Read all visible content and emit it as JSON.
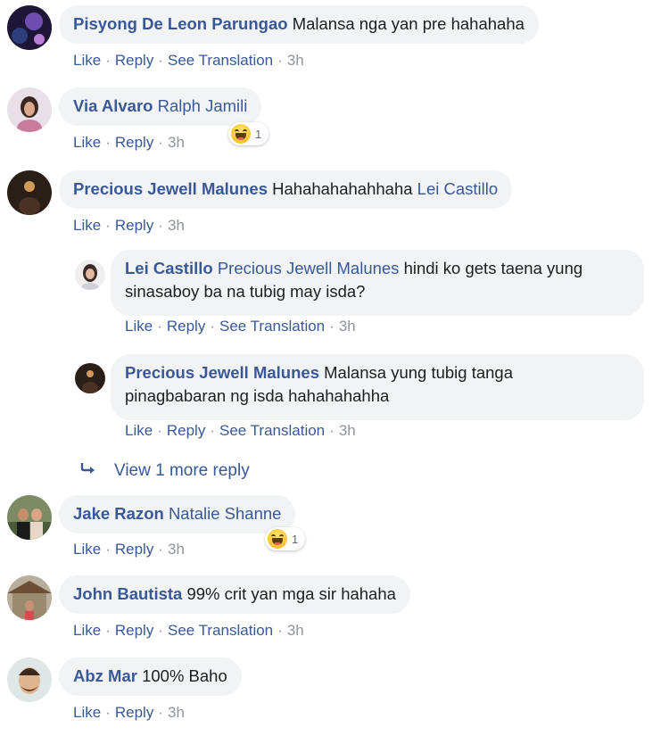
{
  "actions": {
    "like": "Like",
    "reply": "Reply",
    "see_translation": "See Translation",
    "time": "3h",
    "dot": "·"
  },
  "comments": [
    {
      "author": "Pisyong De Leon Parungao",
      "mention": "",
      "text": "Malansa nga yan pre hahahaha"
    },
    {
      "author": "Via Alvaro",
      "mention": "Ralph Jamili",
      "text": "",
      "reaction_count": "1"
    },
    {
      "author": "Precious Jewell Malunes",
      "mention": "Lei Castillo",
      "text": "Hahahahahahhaha"
    },
    {
      "author": "Lei Castillo",
      "mention": "Precious Jewell Malunes",
      "text_line1": "hindi ko gets taena yung",
      "text_line2": "sinasaboy ba na tubig may isda?"
    },
    {
      "author": "Precious Jewell Malunes",
      "mention": "",
      "text_line1": "Malansa yung tubig tanga",
      "text_line2": "pinagbabaran ng isda hahahahahha"
    },
    {
      "author": "Jake Razon",
      "mention": "Natalie Shanne",
      "text": "",
      "reaction_count": "1"
    },
    {
      "author": "John Bautista",
      "mention": "",
      "text": "99% crit yan mga sir hahaha"
    },
    {
      "author": "Abz Mar",
      "mention": "",
      "text": "100% Baho"
    }
  ],
  "view_more": {
    "label": "View 1 more reply",
    "icon": "reply-arrow-icon"
  },
  "colors": {
    "link": "#385898",
    "meta": "#90949c",
    "bubble": "#f2f3f5"
  }
}
